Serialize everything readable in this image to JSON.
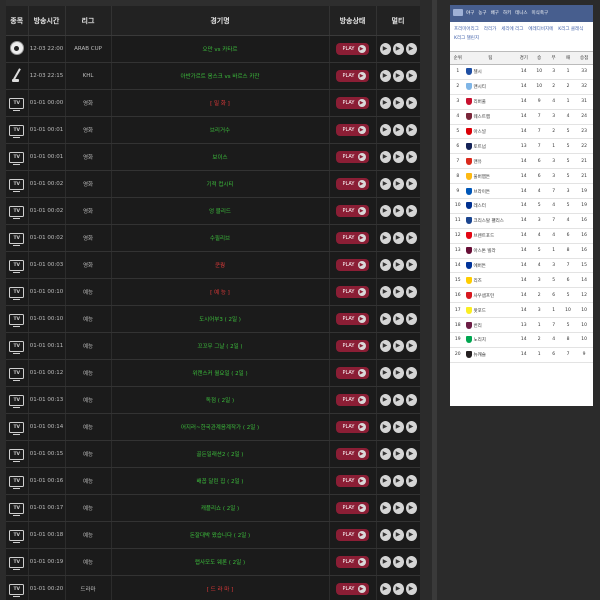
{
  "schedule": {
    "headers": [
      "종목",
      "방송시간",
      "리그",
      "경기명",
      "방송상태",
      "멀티"
    ],
    "play_label": "PLAY",
    "rows": [
      {
        "icon": "soccer",
        "time": "12-03 22:00",
        "league": "ARAB CUP",
        "title": "오만 vs 카타르",
        "color": "green"
      },
      {
        "icon": "hockey",
        "time": "12-03 22:15",
        "league": "KHL",
        "title": "아반가르트 옴스크 vs 바르스 카잔",
        "color": "green"
      },
      {
        "icon": "tv",
        "time": "01-01 00:00",
        "league": "영화",
        "title": "[ 밀 화 ]",
        "color": "red"
      },
      {
        "icon": "tv",
        "time": "01-01 00:01",
        "league": "영화",
        "title": "브리거수",
        "color": "green"
      },
      {
        "icon": "tv",
        "time": "01-01 00:01",
        "league": "영화",
        "title": "보이스",
        "color": "green"
      },
      {
        "icon": "tv",
        "time": "01-01 00:02",
        "league": "영화",
        "title": "기적 컵시티",
        "color": "green"
      },
      {
        "icon": "tv",
        "time": "01-01 00:02",
        "league": "영화",
        "title": "엉 블리드",
        "color": "green"
      },
      {
        "icon": "tv",
        "time": "01-01 00:02",
        "league": "영화",
        "title": "수필리브",
        "color": "green"
      },
      {
        "icon": "tv",
        "time": "01-01 00:03",
        "league": "영화",
        "title": "쿤퀑",
        "color": "red"
      },
      {
        "icon": "tv",
        "time": "01-01 00:10",
        "league": "예능",
        "title": "[ 예 능 ]",
        "color": "red"
      },
      {
        "icon": "tv",
        "time": "01-01 00:10",
        "league": "예능",
        "title": "도시어부3 ( 2일 )",
        "color": "green"
      },
      {
        "icon": "tv",
        "time": "01-01 00:11",
        "league": "예능",
        "title": "꼬꼬무 그날 ( 2일 )",
        "color": "green"
      },
      {
        "icon": "tv",
        "time": "01-01 00:12",
        "league": "예능",
        "title": "위캔스커 월요일 ( 2일 )",
        "color": "green"
      },
      {
        "icon": "tv",
        "time": "01-01 00:13",
        "league": "예능",
        "title": "독점 ( 2일 )",
        "color": "green"
      },
      {
        "icon": "tv",
        "time": "01-01 00:14",
        "league": "예능",
        "title": "어지러~한국관계음계작가 ( 2일 )",
        "color": "green"
      },
      {
        "icon": "tv",
        "time": "01-01 00:15",
        "league": "예능",
        "title": "골든일래션2 ( 2일 )",
        "color": "green"
      },
      {
        "icon": "tv",
        "time": "01-01 00:16",
        "league": "예능",
        "title": "배꼽 달린 집 ( 2일 )",
        "color": "green"
      },
      {
        "icon": "tv",
        "time": "01-01 00:17",
        "league": "예능",
        "title": "캐플리쇼 ( 2일 )",
        "color": "green"
      },
      {
        "icon": "tv",
        "time": "01-01 00:18",
        "league": "예능",
        "title": "돈잘대박 왔습니다 ( 2일 )",
        "color": "green"
      },
      {
        "icon": "tv",
        "time": "01-01 00:19",
        "league": "예능",
        "title": "랩사모도 웨론 ( 2일 )",
        "color": "green"
      },
      {
        "icon": "tv",
        "time": "01-01 00:20",
        "league": "드라마",
        "title": "[ 드 라 마 ]",
        "color": "red"
      }
    ]
  },
  "standings": {
    "sport_tabs": [
      "야구",
      "농구",
      "배구",
      "하키",
      "테니스",
      "미식축구"
    ],
    "leagues": [
      "프리미어리그",
      "라리가",
      "세리에 리그",
      "에레디비지에",
      "K리그 클래식",
      "K리그 챌린지"
    ],
    "headers": [
      "순위",
      "팀",
      "경기",
      "승",
      "무",
      "패",
      "승점"
    ],
    "rows": [
      {
        "rank": "1",
        "team": "첼시",
        "p": "14",
        "w": "10",
        "d": "3",
        "l": "1",
        "pts": "33",
        "color": "#1f4fa3"
      },
      {
        "rank": "2",
        "team": "맨시티",
        "p": "14",
        "w": "10",
        "d": "2",
        "l": "2",
        "pts": "32",
        "color": "#7fb5e6"
      },
      {
        "rank": "3",
        "team": "리버풀",
        "p": "14",
        "w": "9",
        "d": "4",
        "l": "1",
        "pts": "31",
        "color": "#c8102e"
      },
      {
        "rank": "4",
        "team": "웨스트햄",
        "p": "14",
        "w": "7",
        "d": "3",
        "l": "4",
        "pts": "24",
        "color": "#7a263a"
      },
      {
        "rank": "5",
        "team": "아스널",
        "p": "14",
        "w": "7",
        "d": "2",
        "l": "5",
        "pts": "23",
        "color": "#db0007"
      },
      {
        "rank": "6",
        "team": "토트넘",
        "p": "13",
        "w": "7",
        "d": "1",
        "l": "5",
        "pts": "22",
        "color": "#132257"
      },
      {
        "rank": "7",
        "team": "맨유",
        "p": "14",
        "w": "6",
        "d": "3",
        "l": "5",
        "pts": "21",
        "color": "#da291c"
      },
      {
        "rank": "8",
        "team": "울버햄튼",
        "p": "14",
        "w": "6",
        "d": "3",
        "l": "5",
        "pts": "21",
        "color": "#fdb913"
      },
      {
        "rank": "9",
        "team": "브라이튼",
        "p": "14",
        "w": "4",
        "d": "7",
        "l": "3",
        "pts": "19",
        "color": "#0057b8"
      },
      {
        "rank": "10",
        "team": "레스터",
        "p": "14",
        "w": "5",
        "d": "4",
        "l": "5",
        "pts": "19",
        "color": "#003090"
      },
      {
        "rank": "11",
        "team": "크리스탈 팰리스",
        "p": "14",
        "w": "3",
        "d": "7",
        "l": "4",
        "pts": "16",
        "color": "#1b458f"
      },
      {
        "rank": "12",
        "team": "브렌트포드",
        "p": "14",
        "w": "4",
        "d": "4",
        "l": "6",
        "pts": "16",
        "color": "#e30613"
      },
      {
        "rank": "13",
        "team": "아스톤 빌라",
        "p": "14",
        "w": "5",
        "d": "1",
        "l": "8",
        "pts": "16",
        "color": "#670e36"
      },
      {
        "rank": "14",
        "team": "에버튼",
        "p": "14",
        "w": "4",
        "d": "3",
        "l": "7",
        "pts": "15",
        "color": "#003399"
      },
      {
        "rank": "15",
        "team": "리즈",
        "p": "14",
        "w": "3",
        "d": "5",
        "l": "6",
        "pts": "14",
        "color": "#ffcd00"
      },
      {
        "rank": "16",
        "team": "사우샘프턴",
        "p": "14",
        "w": "2",
        "d": "6",
        "l": "5",
        "pts": "12",
        "color": "#d71920"
      },
      {
        "rank": "17",
        "team": "왓포드",
        "p": "14",
        "w": "3",
        "d": "1",
        "l": "10",
        "pts": "10",
        "color": "#fbee23"
      },
      {
        "rank": "18",
        "team": "번리",
        "p": "13",
        "w": "1",
        "d": "7",
        "l": "5",
        "pts": "10",
        "color": "#6c1d45"
      },
      {
        "rank": "19",
        "team": "노리치",
        "p": "14",
        "w": "2",
        "d": "4",
        "l": "8",
        "pts": "10",
        "color": "#00a650"
      },
      {
        "rank": "20",
        "team": "뉴캐슬",
        "p": "14",
        "w": "1",
        "d": "6",
        "l": "7",
        "pts": "9",
        "color": "#241f20"
      }
    ]
  }
}
